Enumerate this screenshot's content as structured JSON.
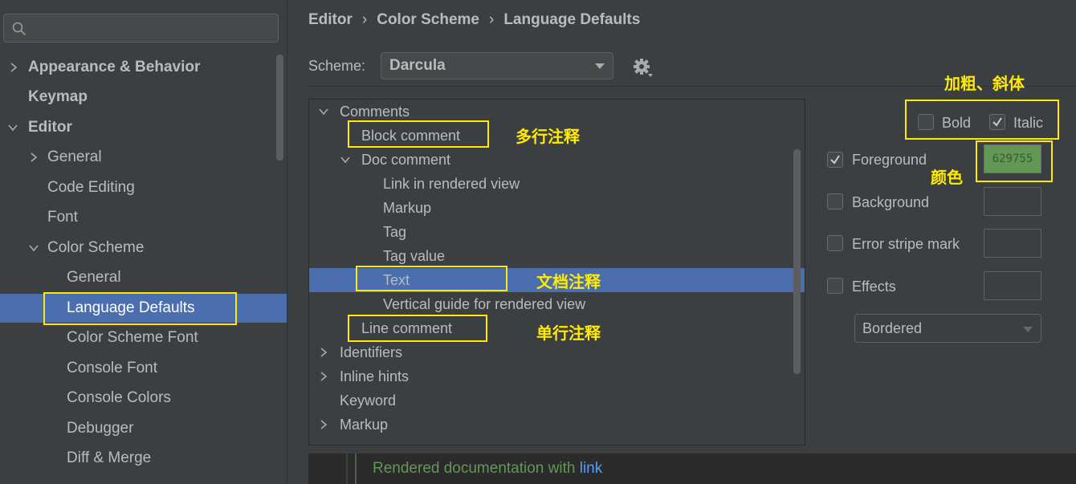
{
  "sidebar": {
    "search_placeholder": "",
    "items": [
      {
        "label": "Appearance & Behavior",
        "expanded": false
      },
      {
        "label": "Keymap"
      },
      {
        "label": "Editor",
        "expanded": true
      },
      {
        "label": "General",
        "expanded": false
      },
      {
        "label": "Code Editing"
      },
      {
        "label": "Font"
      },
      {
        "label": "Color Scheme",
        "expanded": true
      },
      {
        "label": "General"
      },
      {
        "label": "Language Defaults",
        "selected": true
      },
      {
        "label": "Color Scheme Font"
      },
      {
        "label": "Console Font"
      },
      {
        "label": "Console Colors"
      },
      {
        "label": "Debugger"
      },
      {
        "label": "Diff & Merge"
      }
    ]
  },
  "breadcrumb": [
    "Editor",
    "Color Scheme",
    "Language Defaults"
  ],
  "breadcrumb_separator": "›",
  "scheme": {
    "label": "Scheme:",
    "value": "Darcula"
  },
  "tree": {
    "rows": [
      {
        "label": "Comments",
        "expanded": true
      },
      {
        "label": "Block comment"
      },
      {
        "label": "Doc comment",
        "expanded": true
      },
      {
        "label": "Link in rendered view"
      },
      {
        "label": "Markup"
      },
      {
        "label": "Tag"
      },
      {
        "label": "Tag value"
      },
      {
        "label": "Text",
        "selected": true
      },
      {
        "label": "Vertical guide for rendered view"
      },
      {
        "label": "Line comment"
      },
      {
        "label": "Identifiers",
        "expanded": false
      },
      {
        "label": "Inline hints",
        "expanded": false
      },
      {
        "label": "Keyword"
      },
      {
        "label": "Markup",
        "expanded": false
      }
    ]
  },
  "options": {
    "bold": {
      "label": "Bold",
      "checked": false
    },
    "italic": {
      "label": "Italic",
      "checked": true
    },
    "foreground": {
      "label": "Foreground",
      "checked": true,
      "color_hex": "629755",
      "color": "#629755"
    },
    "background": {
      "label": "Background",
      "checked": false
    },
    "error_stripe": {
      "label": "Error stripe mark",
      "checked": false
    },
    "effects": {
      "label": "Effects",
      "checked": false,
      "type": "Bordered"
    }
  },
  "preview": {
    "text": "Rendered documentation with ",
    "link": "link"
  },
  "annotations": {
    "bold_italic": "加粗、斜体",
    "color": "颜色",
    "block_comment": "多行注释",
    "doc_comment": "文档注释",
    "line_comment": "单行注释"
  },
  "colors": {
    "accent": "#4b6eaf",
    "annotation": "#ffeb00",
    "foreground": "#629755",
    "link": "#589df6"
  }
}
